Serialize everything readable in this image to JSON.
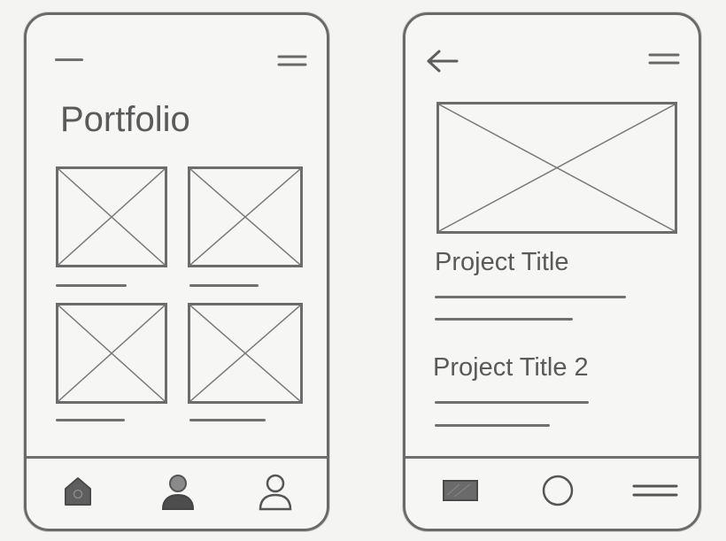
{
  "screens": {
    "list": {
      "title": "Portfolio",
      "tabbar": {
        "icons": [
          "home-icon",
          "user-icon",
          "profile-icon"
        ]
      }
    },
    "detail": {
      "project_title": "Project Title",
      "project_title_2": "Project Title 2",
      "tabbar": {
        "icons": [
          "image-icon",
          "circle-icon",
          "menu-icon"
        ]
      }
    }
  }
}
